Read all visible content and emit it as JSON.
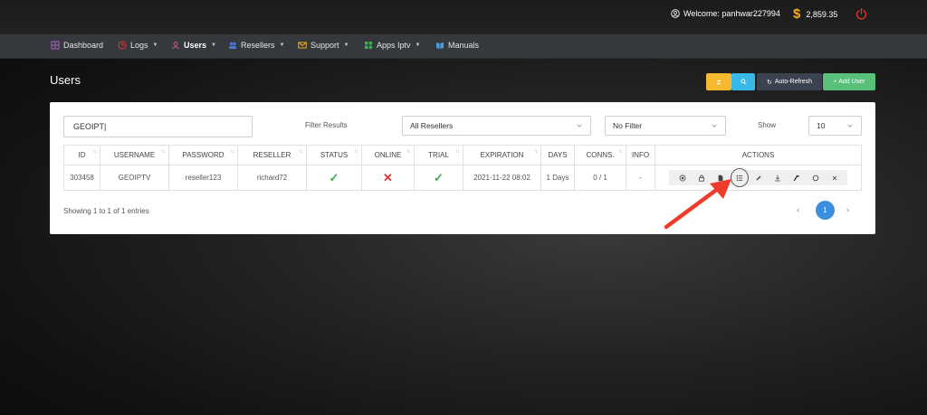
{
  "header": {
    "welcome": "Welcome: panhwar227994",
    "balance": "2,859.35",
    "currency_symbol": "$"
  },
  "nav": {
    "items": [
      {
        "label": "Dashboard",
        "icon": "dashboard-icon",
        "dropdown": false
      },
      {
        "label": "Logs",
        "icon": "logs-icon",
        "dropdown": true
      },
      {
        "label": "Users",
        "icon": "users-icon",
        "dropdown": true
      },
      {
        "label": "Resellers",
        "icon": "resellers-icon",
        "dropdown": true
      },
      {
        "label": "Support",
        "icon": "support-icon",
        "dropdown": true
      },
      {
        "label": "Apps Iptv",
        "icon": "apps-icon",
        "dropdown": true
      },
      {
        "label": "Manuals",
        "icon": "manuals-icon",
        "dropdown": false
      }
    ]
  },
  "page": {
    "title": "Users",
    "buttons": {
      "auto_refresh": "Auto-Refresh",
      "add_user": "+ Add User"
    }
  },
  "filters": {
    "search_value": "GEOIPT",
    "filter_results_label": "Filter Results",
    "resellers_selected": "All Resellers",
    "filter_selected": "No Filter",
    "show_label": "Show",
    "show_selected": "10"
  },
  "table": {
    "columns": [
      "ID",
      "USERNAME",
      "PASSWORD",
      "RESELLER",
      "STATUS",
      "ONLINE",
      "TRIAL",
      "EXPIRATION",
      "DAYS",
      "CONNS.",
      "INFO",
      "ACTIONS"
    ],
    "rows": [
      {
        "id": "303458",
        "username": "GEOIPTV",
        "password": "reseller123",
        "reseller": "richard72",
        "status": "check",
        "online": "cross",
        "trial": "check",
        "expiration": "2021-11-22 08:02",
        "days": "1 Days",
        "conns": "0 / 1",
        "info": "-"
      }
    ]
  },
  "footer": {
    "entries_text": "Showing 1 to 1 of 1 entries",
    "current_page": "1",
    "prev": "‹",
    "next": "›"
  },
  "colors": {
    "accent_blue": "#3c8ede",
    "success": "#3cae54",
    "danger": "#e3342f",
    "warning": "#f5b82e",
    "info": "#38b9e8",
    "add_green": "#59c07a",
    "annotation_arrow": "#ef3b2a"
  }
}
